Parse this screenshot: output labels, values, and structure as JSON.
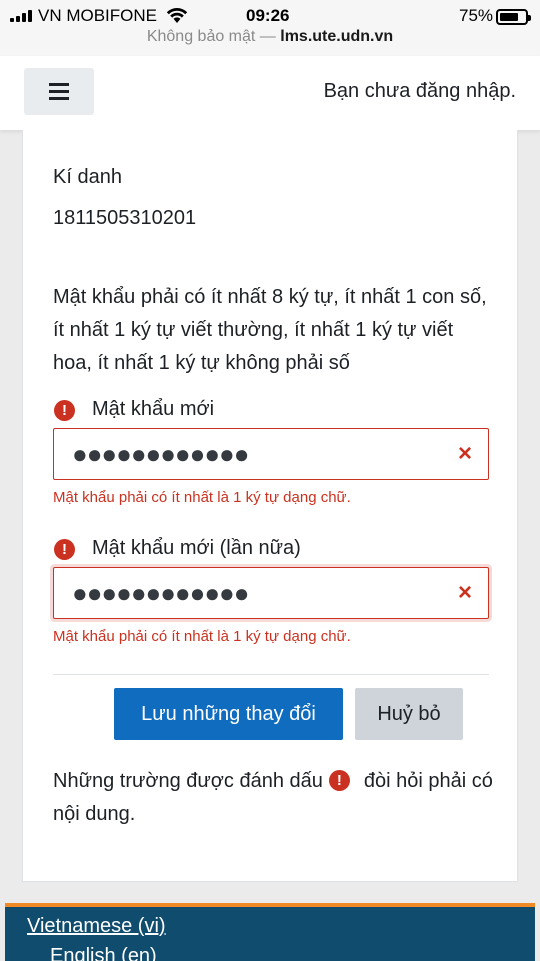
{
  "status_bar": {
    "carrier": "VN MOBIFONE",
    "time": "09:26",
    "battery": "75%",
    "battery_level": 0.75,
    "url_prefix": "Không bảo mật —",
    "url_domain": "lms.ute.udn.vn"
  },
  "navbar": {
    "menu_icon": "hamburger-icon",
    "login_status": "Bạn chưa đăng nhập."
  },
  "form": {
    "username_label": "Kí danh",
    "username_value": "1811505310201",
    "password_policy": "Mật khẩu phải có ít nhất 8 ký tự, ít nhất 1 con số, ít nhất 1 ký tự viết thường, ít nhất 1 ký tự viết hoa, ít nhất 1 ký tự không phải số",
    "required_icon": "!",
    "new_password": {
      "label": "Mật khẩu mới",
      "masked_value": "●●●●●●●●●●●●",
      "error": "Mật khẩu phải có ít nhất là 1 ký tự dạng chữ."
    },
    "new_password_again": {
      "label": "Mật khẩu mới (lần nữa)",
      "masked_value": "●●●●●●●●●●●●",
      "error": "Mật khẩu phải có ít nhất là 1 ký tự dạng chữ."
    },
    "clear_icon": "×",
    "save_button": "Lưu những thay đổi",
    "cancel_button": "Huỷ bỏ",
    "required_note_before": "Những trường được đánh dấu",
    "required_note_after": "đòi hỏi phải có nội dung."
  },
  "footer": {
    "languages": [
      "Vietnamese (vi)",
      "English (en)"
    ]
  },
  "colors": {
    "primary": "#0f6cbf",
    "error": "#ca3120",
    "footer_bg": "#0f4c6e",
    "footer_accent": "#f08a24"
  }
}
